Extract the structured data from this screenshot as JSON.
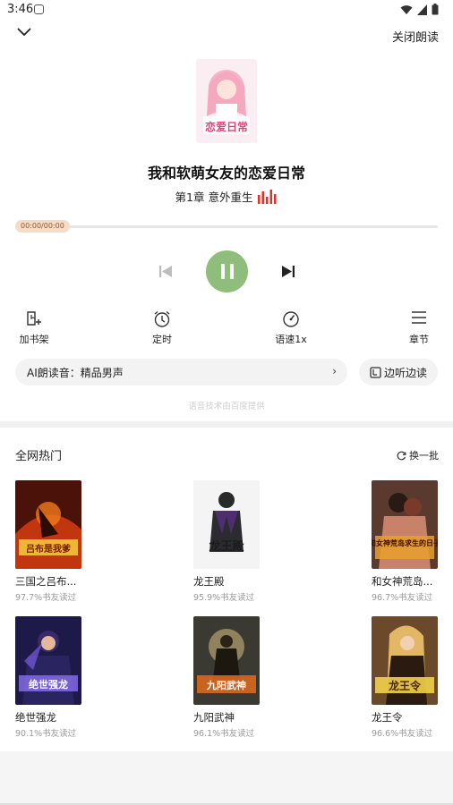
{
  "status_bar": {
    "time": "3:46"
  },
  "header": {
    "close_label": "关闭朗读"
  },
  "book": {
    "title": "我和软萌女友的恋爱日常",
    "cover_text": "恋爱日常",
    "chapter": "第1章 意外重生"
  },
  "player": {
    "time_label": "00:00/00:00",
    "progress": 0
  },
  "tools": [
    {
      "label": "加书架",
      "icon": "add-bookshelf-icon"
    },
    {
      "label": "定时",
      "icon": "alarm-clock-icon"
    },
    {
      "label": "语速1x",
      "icon": "speedometer-icon"
    },
    {
      "label": "章节",
      "icon": "menu-list-icon"
    }
  ],
  "ai_voice": {
    "label": "AI朗读音：精品男声"
  },
  "listen_read": {
    "label": "边听边读"
  },
  "powered_by": "语音技术由百度提供",
  "hot": {
    "title": "全网热门",
    "refresh_label": "换一批",
    "books": [
      {
        "name": "三国之吕布...",
        "pct": "97.7%书友读过",
        "cover_text": "吕布是我爹"
      },
      {
        "name": "龙王殿",
        "pct": "95.9%书友读过",
        "cover_text": "龙王殿"
      },
      {
        "name": "和女神荒岛...",
        "pct": "96.7%书友读过",
        "cover_text": "和女神荒岛求生的日子"
      },
      {
        "name": "绝世强龙",
        "pct": "90.1%书友读过",
        "cover_text": "绝世强龙"
      },
      {
        "name": "九阳武神",
        "pct": "96.1%书友读过",
        "cover_text": "九阳武神"
      },
      {
        "name": "龙王令",
        "pct": "96.6%书友读过",
        "cover_text": "龙王令"
      }
    ]
  },
  "colors": {
    "play": "#8fbd7c",
    "accent_red": "#e0322a",
    "progress_thumb": "#f6dcc6"
  }
}
